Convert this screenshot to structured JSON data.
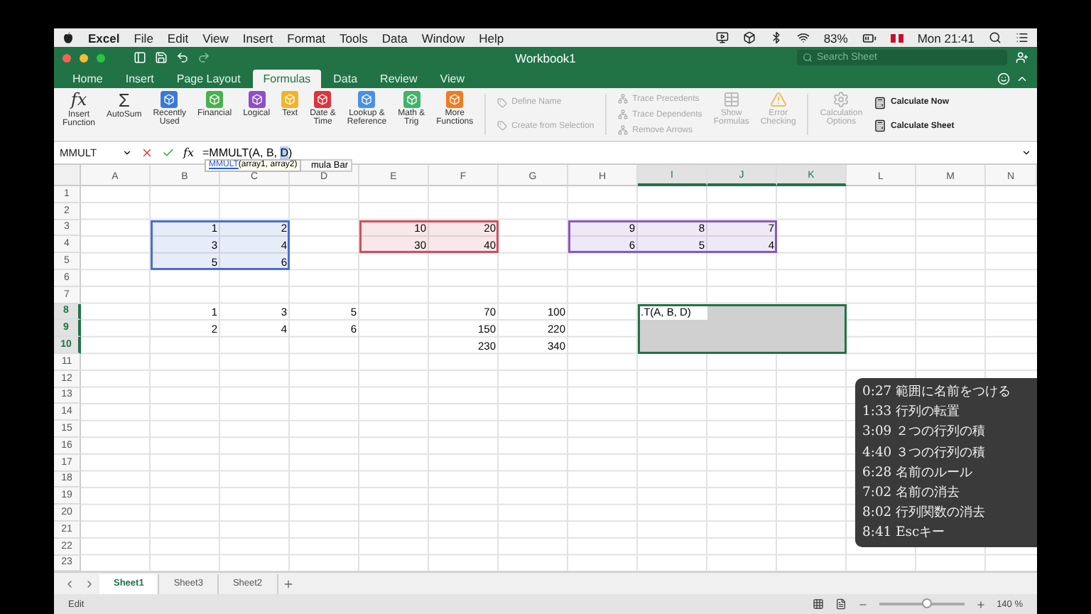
{
  "menu_bar": {
    "app": "Excel",
    "items": [
      "File",
      "Edit",
      "View",
      "Insert",
      "Format",
      "Tools",
      "Data",
      "Window",
      "Help"
    ],
    "battery": "83%",
    "clock": "Mon 21:41"
  },
  "title_bar": {
    "title": "Workbook1",
    "search": {
      "placeholder": "Search Sheet"
    }
  },
  "ribbon_tabs": [
    {
      "label": "Home",
      "selected": false
    },
    {
      "label": "Insert",
      "selected": false
    },
    {
      "label": "Page Layout",
      "selected": false
    },
    {
      "label": "Formulas",
      "selected": true
    },
    {
      "label": "Data",
      "selected": false
    },
    {
      "label": "Review",
      "selected": false
    },
    {
      "label": "View",
      "selected": false
    }
  ],
  "ribbon": {
    "function_library": [
      {
        "label": "Insert\nFunction",
        "kind": "fx",
        "glyph": "fx"
      },
      {
        "label": "AutoSum",
        "kind": "sigma",
        "glyph": "Σ"
      },
      {
        "label": "Recently\nUsed",
        "kind": "tile",
        "color": "#3a78d8"
      },
      {
        "label": "Financial",
        "kind": "tile",
        "color": "#4caf50"
      },
      {
        "label": "Logical",
        "kind": "tile",
        "color": "#8e4fc4"
      },
      {
        "label": "Text",
        "kind": "tile",
        "color": "#f0b429"
      },
      {
        "label": "Date &\nTime",
        "kind": "tile",
        "color": "#d9363e"
      },
      {
        "label": "Lookup &\nReference",
        "kind": "tile",
        "color": "#4a90e2"
      },
      {
        "label": "Math &\nTrig",
        "kind": "tile",
        "color": "#43b36b"
      },
      {
        "label": "More\nFunctions",
        "kind": "tile",
        "color": "#f07b22"
      }
    ],
    "defined_names": [
      {
        "label": "Define Name",
        "disabled": true
      },
      {
        "label": "Create from Selection",
        "disabled": true
      }
    ],
    "auditing": [
      {
        "label": "Trace Precedents",
        "disabled": true
      },
      {
        "label": "Trace Dependents",
        "disabled": true
      },
      {
        "label": "Remove Arrows",
        "disabled": true
      }
    ],
    "audit_tools": [
      {
        "label": "Show\nFormulas",
        "disabled": true
      },
      {
        "label": "Error\nChecking",
        "disabled": true
      }
    ],
    "calculation_options": {
      "label": "Calculation\nOptions",
      "disabled": true
    },
    "calculate": [
      {
        "label": "Calculate Now",
        "disabled": false
      },
      {
        "label": "Calculate Sheet",
        "disabled": false
      }
    ]
  },
  "formula_bar": {
    "name_box": "MMULT",
    "function_button": "fx",
    "formula_start": "=MMULT(A, B, ",
    "formula_highlight": "D",
    "formula_end": ")",
    "tooltip_function": "MMULT",
    "tooltip_args": "(array1, array2)",
    "hidden_tooltip": "mula Bar"
  },
  "sheet": {
    "columns": [
      {
        "label": "A",
        "selected": false
      },
      {
        "label": "B",
        "selected": false
      },
      {
        "label": "C",
        "selected": false
      },
      {
        "label": "D",
        "selected": false
      },
      {
        "label": "E",
        "selected": false
      },
      {
        "label": "F",
        "selected": false
      },
      {
        "label": "G",
        "selected": false
      },
      {
        "label": "H",
        "selected": false
      },
      {
        "label": "I",
        "selected": true
      },
      {
        "label": "J",
        "selected": true
      },
      {
        "label": "K",
        "selected": true
      },
      {
        "label": "L",
        "selected": false
      },
      {
        "label": "M",
        "selected": false
      },
      {
        "label": "N",
        "selected": false
      }
    ],
    "rows": [
      {
        "label": "1",
        "selected": false,
        "cells": []
      },
      {
        "label": "2",
        "selected": false,
        "cells": []
      },
      {
        "label": "3",
        "selected": false,
        "cells": [
          null,
          {
            "text": "1",
            "color": "#4a6fd0"
          },
          {
            "text": "2",
            "color": "#4a6fd0"
          },
          null,
          {
            "text": "10",
            "color": "#d0505e"
          },
          {
            "text": "20",
            "color": "#d0505e"
          },
          null,
          {
            "text": "9",
            "color": "#8a58c0"
          },
          {
            "text": "8",
            "color": "#8a58c0"
          },
          {
            "text": "7",
            "color": "#8a58c0"
          }
        ]
      },
      {
        "label": "4",
        "selected": false,
        "cells": [
          null,
          {
            "text": "3",
            "color": "#4a6fd0"
          },
          {
            "text": "4",
            "color": "#4a6fd0"
          },
          null,
          {
            "text": "30",
            "color": "#d0505e"
          },
          {
            "text": "40",
            "color": "#d0505e"
          },
          null,
          {
            "text": "6",
            "color": "#8a58c0"
          },
          {
            "text": "5",
            "color": "#8a58c0"
          },
          {
            "text": "4",
            "color": "#8a58c0"
          }
        ]
      },
      {
        "label": "5",
        "selected": false,
        "cells": [
          null,
          {
            "text": "5",
            "color": "#4a6fd0"
          },
          {
            "text": "6",
            "color": "#4a6fd0"
          }
        ]
      },
      {
        "label": "6",
        "selected": false,
        "cells": []
      },
      {
        "label": "7",
        "selected": false,
        "cells": []
      },
      {
        "label": "8",
        "selected": true,
        "cells": [
          null,
          {
            "text": "1"
          },
          {
            "text": "3"
          },
          {
            "text": "5"
          },
          null,
          {
            "text": "70"
          },
          {
            "text": "100"
          },
          null,
          {
            "text": ".T(A, B, D)",
            "selected": true,
            "editing": true
          },
          {
            "selected": true
          },
          {
            "selected": true
          }
        ]
      },
      {
        "label": "9",
        "selected": true,
        "cells": [
          null,
          {
            "text": "2"
          },
          {
            "text": "4"
          },
          {
            "text": "6"
          },
          null,
          {
            "text": "150"
          },
          {
            "text": "220"
          },
          null,
          {
            "selected": true
          },
          {
            "selected": true
          },
          {
            "selected": true
          }
        ]
      },
      {
        "label": "10",
        "selected": true,
        "cells": [
          null,
          null,
          null,
          null,
          null,
          {
            "text": "230"
          },
          {
            "text": "340"
          },
          null,
          {
            "selected": true
          },
          {
            "selected": true
          },
          {
            "selected": true
          }
        ]
      },
      {
        "label": "11",
        "selected": false,
        "cells": []
      },
      {
        "label": "12",
        "selected": false,
        "cells": []
      },
      {
        "label": "13",
        "selected": false,
        "cells": []
      },
      {
        "label": "14",
        "selected": false,
        "cells": []
      },
      {
        "label": "15",
        "selected": false,
        "cells": []
      },
      {
        "label": "16",
        "selected": false,
        "cells": []
      },
      {
        "label": "17",
        "selected": false,
        "cells": []
      },
      {
        "label": "18",
        "selected": false,
        "cells": []
      },
      {
        "label": "19",
        "selected": false,
        "cells": []
      },
      {
        "label": "20",
        "selected": false,
        "cells": []
      },
      {
        "label": "21",
        "selected": false,
        "cells": []
      },
      {
        "label": "22",
        "selected": false,
        "cells": []
      },
      {
        "label": "23",
        "selected": false,
        "cells": []
      }
    ]
  },
  "chapters": [
    {
      "time": "0:27",
      "title": "範囲に名前をつける"
    },
    {
      "time": "1:33",
      "title": "行列の転置"
    },
    {
      "time": "3:09",
      "title": "２つの行列の積"
    },
    {
      "time": "4:40",
      "title": "３つの行列の積"
    },
    {
      "time": "6:28",
      "title": "名前のルール"
    },
    {
      "time": "7:02",
      "title": "名前の消去"
    },
    {
      "time": "8:02",
      "title": "行列関数の消去"
    },
    {
      "time": "8:41",
      "title": "Escキー"
    }
  ],
  "sheet_tabs": [
    {
      "label": "Sheet1",
      "selected": true
    },
    {
      "label": "Sheet3",
      "selected": false
    },
    {
      "label": "Sheet2",
      "selected": false
    }
  ],
  "status_bar": {
    "mode": "Edit",
    "zoom": {
      "level": 0.55
    },
    "zoom_text": "140 %"
  }
}
